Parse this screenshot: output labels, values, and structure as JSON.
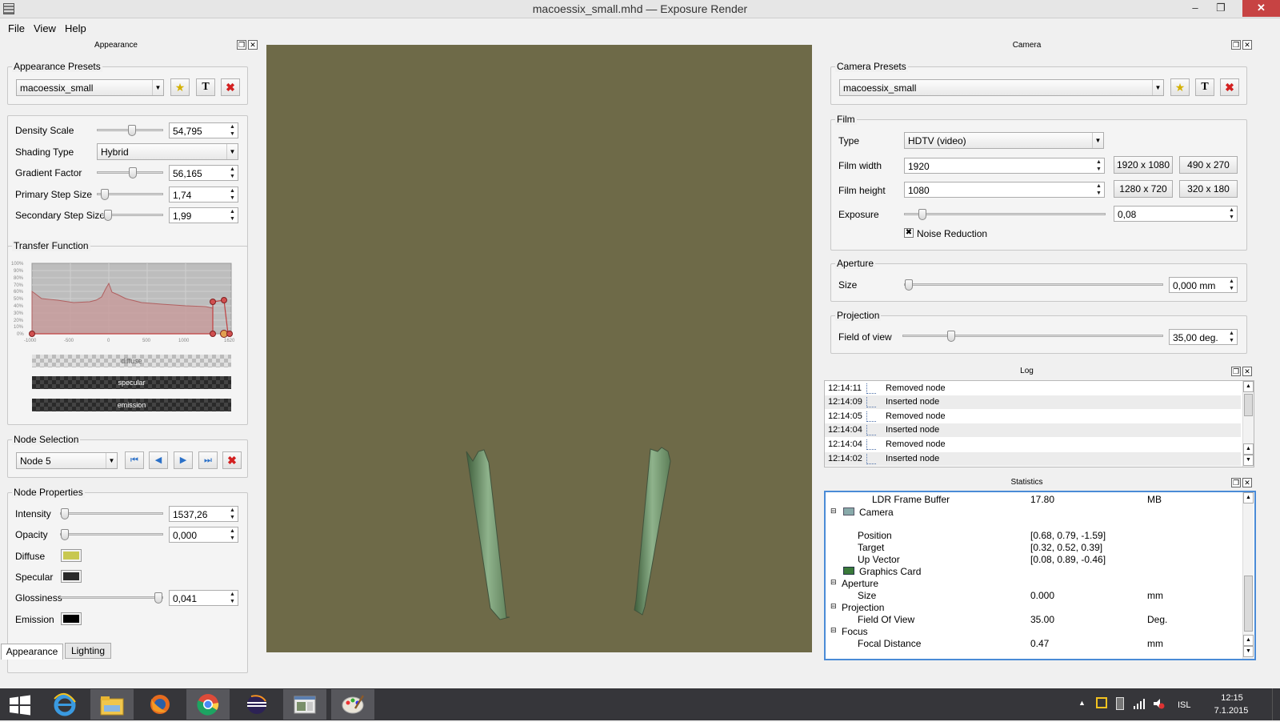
{
  "window": {
    "title": "macoessix_small.mhd — Exposure Render",
    "minimize": "–",
    "restore": "❐",
    "close": "✕"
  },
  "menu": [
    "File",
    "View",
    "Help"
  ],
  "appearance": {
    "dock_title": "Appearance",
    "presets_title": "Appearance Presets",
    "preset_value": "macoessix_small",
    "density_label": "Density Scale",
    "density_value": "54,795",
    "shading_label": "Shading Type",
    "shading_value": "Hybrid",
    "gradient_label": "Gradient Factor",
    "gradient_value": "56,165",
    "primary_label": "Primary Step Size",
    "primary_value": "1,74",
    "secondary_label": "Secondary Step Size",
    "secondary_value": "1,99",
    "tf_title": "Transfer Function",
    "tf_y_ticks": [
      "100%",
      "90%",
      "80%",
      "70%",
      "60%",
      "50%",
      "40%",
      "30%",
      "20%",
      "10%",
      "0%"
    ],
    "tf_x_ticks": [
      "-1000",
      "-500",
      "0",
      "500",
      "1000",
      "1620"
    ],
    "tf_bars": [
      "diffuse",
      "specular",
      "emission"
    ],
    "node_sel_title": "Node Selection",
    "node_value": "Node 5",
    "node_props_title": "Node Properties",
    "intensity_label": "Intensity",
    "intensity_value": "1537,26",
    "opacity_label": "Opacity",
    "opacity_value": "0,000",
    "diffuse_label": "Diffuse",
    "specular_label": "Specular",
    "gloss_label": "Glossiness",
    "gloss_value": "0,041",
    "emission_label": "Emission",
    "colors": {
      "diffuse": "#c8c850",
      "specular": "#2b2b2b",
      "emission": "#000000"
    },
    "tabs": [
      "Appearance",
      "Lighting"
    ]
  },
  "camera": {
    "dock_title": "Camera",
    "presets_title": "Camera Presets",
    "preset_value": "macoessix_small",
    "film_title": "Film",
    "type_label": "Type",
    "type_value": "HDTV (video)",
    "width_label": "Film width",
    "width_value": "1920",
    "height_label": "Film height",
    "height_value": "1080",
    "exposure_label": "Exposure",
    "exposure_value": "0,08",
    "res_buttons": [
      "1920 x 1080",
      "490 x 270",
      "1280 x 720",
      "320 x 180"
    ],
    "noise_label": "Noise Reduction",
    "aperture_title": "Aperture",
    "size_label": "Size",
    "size_value": "0,000 mm",
    "projection_title": "Projection",
    "fov_label": "Field of view",
    "fov_value": "35,00 deg."
  },
  "log": {
    "dock_title": "Log",
    "rows": [
      {
        "time": "12:14:11",
        "msg": "Removed node"
      },
      {
        "time": "12:14:09",
        "msg": "Inserted node"
      },
      {
        "time": "12:14:05",
        "msg": "Removed node"
      },
      {
        "time": "12:14:04",
        "msg": "Inserted node"
      },
      {
        "time": "12:14:04",
        "msg": "Removed node"
      },
      {
        "time": "12:14:02",
        "msg": "Inserted node"
      }
    ]
  },
  "statistics": {
    "dock_title": "Statistics",
    "rows": [
      {
        "name": "LDR Frame Buffer",
        "value": "17.80",
        "unit": "MB"
      },
      {
        "name": "Camera",
        "value": "",
        "unit": ""
      },
      {
        "name": "Position",
        "value": "[0.68, 0.79, -1.59]",
        "unit": ""
      },
      {
        "name": "Target",
        "value": "[0.32, 0.52, 0.39]",
        "unit": ""
      },
      {
        "name": "Up Vector",
        "value": "[0.08, 0.89, -0.46]",
        "unit": ""
      },
      {
        "name": "Graphics Card",
        "value": "",
        "unit": ""
      },
      {
        "name": "Aperture",
        "value": "",
        "unit": ""
      },
      {
        "name": "Size",
        "value": "0.000",
        "unit": "mm"
      },
      {
        "name": "Projection",
        "value": "",
        "unit": ""
      },
      {
        "name": "Field Of View",
        "value": "35.00",
        "unit": "Deg."
      },
      {
        "name": "Focus",
        "value": "",
        "unit": ""
      },
      {
        "name": "Focal Distance",
        "value": "0.47",
        "unit": "mm"
      }
    ]
  },
  "render": {
    "background": "#6e6a48"
  },
  "taskbar": {
    "lang": "ISL",
    "time": "12:15",
    "date": "7.1.2015"
  }
}
